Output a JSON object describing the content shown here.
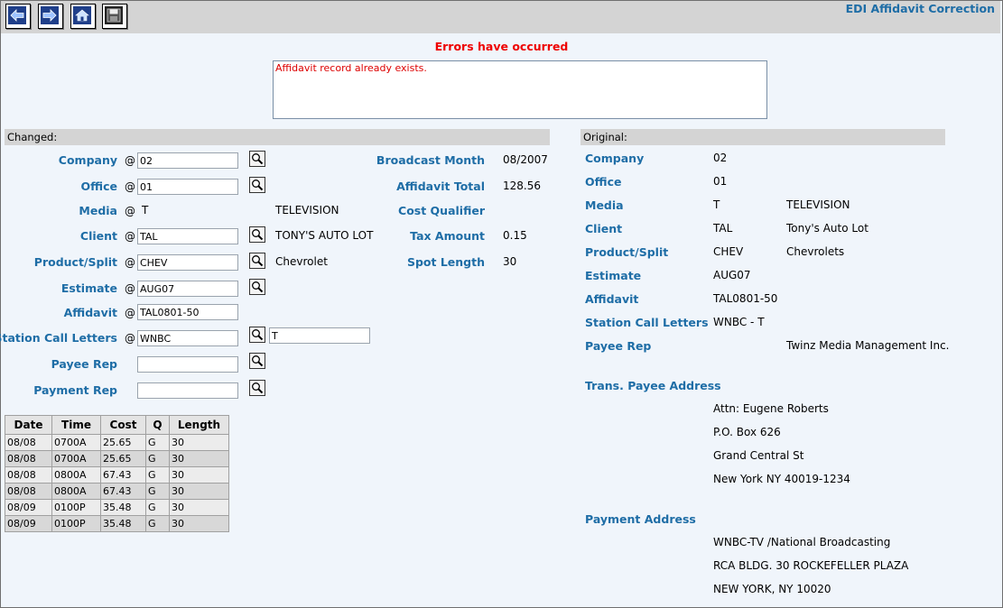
{
  "app_title": "EDI Affidavit Correction",
  "toolbar": {
    "back_icon": "arrow-left-icon",
    "forward_icon": "arrow-right-icon",
    "home_icon": "home-icon",
    "save_icon": "save-icon"
  },
  "errors": {
    "title": "Errors have occurred",
    "message": "Affidavit record already exists."
  },
  "changed": {
    "header": "Changed:",
    "at": "@",
    "labels": {
      "company": "Company",
      "office": "Office",
      "media": "Media",
      "client": "Client",
      "product": "Product/Split",
      "estimate": "Estimate",
      "affidavit": "Affidavit",
      "station": "Station Call Letters",
      "payee_rep": "Payee Rep",
      "payment_rep": "Payment Rep",
      "broadcast_month": "Broadcast Month",
      "affidavit_total": "Affidavit Total",
      "cost_qualifier": "Cost Qualifier",
      "tax_amount": "Tax Amount",
      "spot_length": "Spot Length"
    },
    "values": {
      "company": "02",
      "office": "01",
      "media": "T",
      "media_name": "TELEVISION",
      "client": "TAL",
      "client_name": "TONY'S AUTO LOT",
      "product": "CHEV",
      "product_name": "Chevrolet",
      "estimate": "AUG07",
      "affidavit": "TAL0801-50",
      "station": "WNBC",
      "station_band": "T",
      "payee_rep": "",
      "payment_rep": "",
      "broadcast_month": "08/2007",
      "affidavit_total": "128.56",
      "cost_qualifier": "",
      "tax_amount": "0.15",
      "spot_length": "30"
    }
  },
  "spots": {
    "headers": [
      "Date",
      "Time",
      "Cost",
      "Q",
      "Length"
    ],
    "rows": [
      [
        "08/08",
        "0700A",
        "25.65",
        "G",
        "30"
      ],
      [
        "08/08",
        "0700A",
        "25.65",
        "G",
        "30"
      ],
      [
        "08/08",
        "0800A",
        "67.43",
        "G",
        "30"
      ],
      [
        "08/08",
        "0800A",
        "67.43",
        "G",
        "30"
      ],
      [
        "08/09",
        "0100P",
        "35.48",
        "G",
        "30"
      ],
      [
        "08/09",
        "0100P",
        "35.48",
        "G",
        "30"
      ]
    ]
  },
  "original": {
    "header": "Original:",
    "labels": {
      "company": "Company",
      "office": "Office",
      "media": "Media",
      "client": "Client",
      "product": "Product/Split",
      "estimate": "Estimate",
      "affidavit": "Affidavit",
      "station": "Station Call Letters",
      "payee_rep": "Payee Rep",
      "trans_payee_address": "Trans. Payee Address",
      "payment_address": "Payment Address"
    },
    "values": {
      "company": "02",
      "office": "01",
      "media": "T",
      "media_name": "TELEVISION",
      "client": "TAL",
      "client_name": "Tony's Auto Lot",
      "product": "CHEV",
      "product_name": "Chevrolets",
      "estimate": "AUG07",
      "affidavit": "TAL0801-50",
      "station": "WNBC - T",
      "payee_rep": "Twinz Media Management Inc."
    },
    "trans_payee_address": [
      "Attn: Eugene Roberts",
      "P.O. Box 626",
      "Grand Central St",
      "New York NY 40019-1234"
    ],
    "payment_address": [
      "WNBC-TV /National Broadcasting",
      "RCA BLDG. 30 ROCKEFELLER PLAZA",
      "NEW YORK, NY 10020"
    ]
  }
}
